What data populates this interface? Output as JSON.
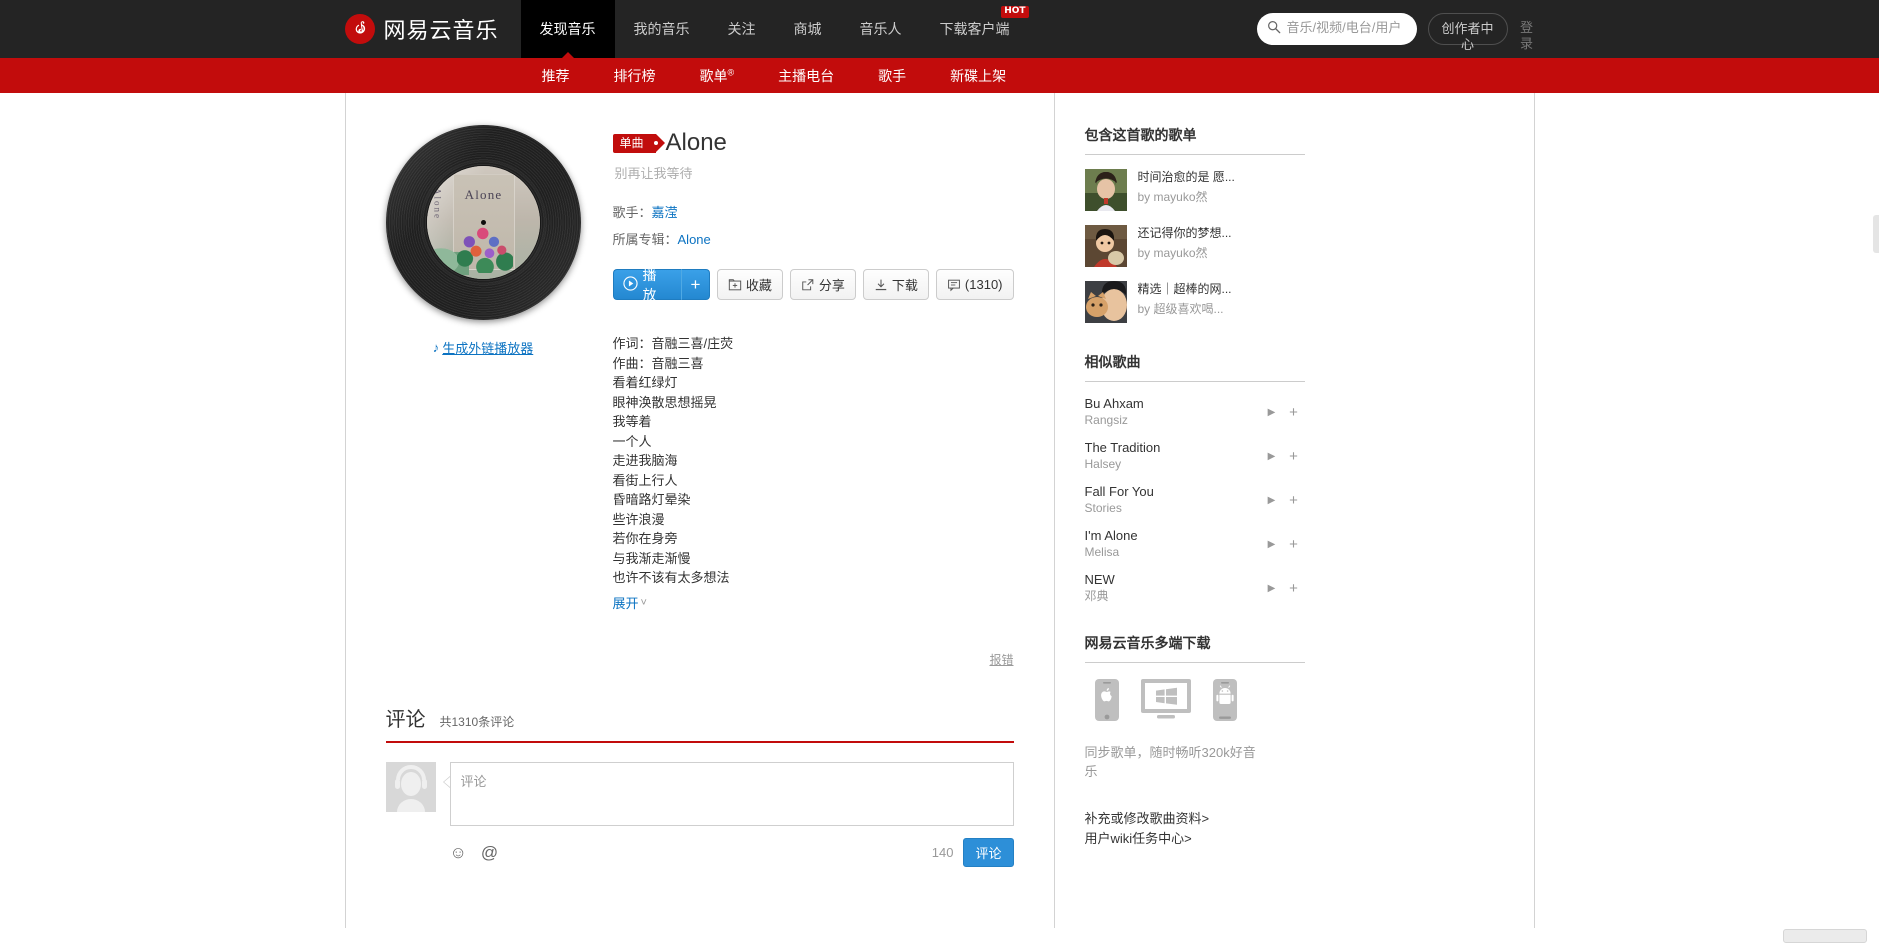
{
  "header": {
    "logo_text": "网易云音乐",
    "logo_icon": "netease-music-logo-icon",
    "nav": [
      {
        "label": "发现音乐",
        "active": true
      },
      {
        "label": "我的音乐",
        "active": false
      },
      {
        "label": "关注",
        "active": false
      },
      {
        "label": "商城",
        "active": false
      },
      {
        "label": "音乐人",
        "active": false
      },
      {
        "label": "下载客户端",
        "active": false,
        "badge": "HOT"
      }
    ],
    "search_placeholder": "音乐/视频/电台/用户",
    "creator_center": "创作者中心",
    "login": "登录"
  },
  "subnav": [
    {
      "label": "推荐",
      "sup": ""
    },
    {
      "label": "排行榜",
      "sup": ""
    },
    {
      "label": "歌单",
      "sup": "®"
    },
    {
      "label": "主播电台",
      "sup": ""
    },
    {
      "label": "歌手",
      "sup": ""
    },
    {
      "label": "新碟上架",
      "sup": ""
    }
  ],
  "song": {
    "tag": "单曲",
    "title": "Alone",
    "alias": "别再让我等待",
    "artist_label": "歌手：",
    "artist": "嘉滢",
    "album_label": "所属专辑：",
    "album": "Alone",
    "cover_title": "Alone",
    "cover_side": "Alone",
    "outlink": "生成外链播放器",
    "buttons": {
      "play": "播放",
      "plus": "+",
      "collect": "收藏",
      "share": "分享",
      "download": "下载",
      "comment_count": "(1310)"
    },
    "lyrics": [
      "作词：音融三喜/庄荧",
      "作曲：音融三喜",
      "看着红绿灯",
      "眼神涣散思想摇晃",
      "我等着",
      "一个人",
      "走进我脑海",
      "看街上行人",
      "昏暗路灯晕染",
      "些许浪漫",
      "若你在身旁",
      "与我渐走渐慢",
      "也许不该有太多想法"
    ],
    "expand": "展开",
    "report": "报错"
  },
  "comments": {
    "title": "评论",
    "count_text": "共1310条评论",
    "input_placeholder": "评论",
    "emoji_icon": "emoji-icon",
    "mention_icon": "at-mention-icon",
    "char_limit": "140",
    "submit": "评论"
  },
  "sidebar": {
    "playlists_title": "包含这首歌的歌单",
    "playlists": [
      {
        "name": "时间治愈的是 愿...",
        "by": "by mayuko然"
      },
      {
        "name": "还记得你的梦想...",
        "by": "by mayuko然"
      },
      {
        "name": "精选｜超棒的网...",
        "by": "by 超级喜欢喝..."
      }
    ],
    "similar_title": "相似歌曲",
    "similar": [
      {
        "name": "Bu Ahxam",
        "artist": "Rangsiz"
      },
      {
        "name": "The Tradition",
        "artist": "Halsey"
      },
      {
        "name": "Fall For You",
        "artist": "Stories"
      },
      {
        "name": "I'm Alone",
        "artist": "Melisa"
      },
      {
        "name": "NEW",
        "artist": "邓典"
      }
    ],
    "download_title": "网易云音乐多端下载",
    "download_icons": [
      "apple-iphone-icon",
      "windows-desktop-icon",
      "android-phone-icon"
    ],
    "download_note": "同步歌单，随时畅听320k好音乐",
    "wiki_links": [
      "补充或修改歌曲资料>",
      "用户wiki任务中心>"
    ]
  },
  "colors": {
    "brand_red": "#c20c0c",
    "link_blue": "#0c73c2",
    "nav_dark": "#242424",
    "button_blue": "#2488d1"
  }
}
